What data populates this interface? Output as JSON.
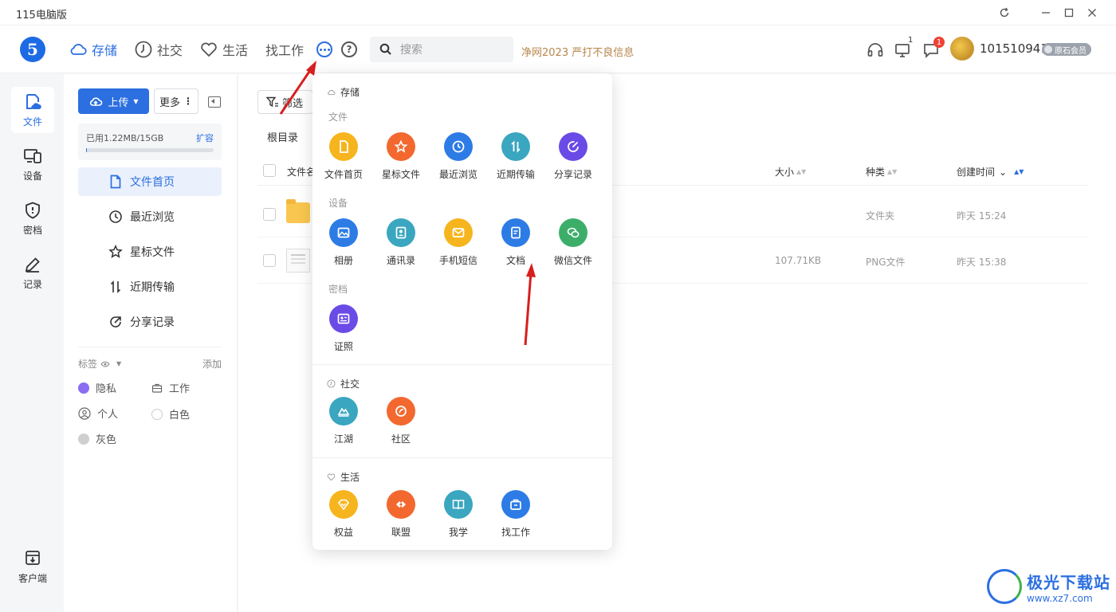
{
  "window": {
    "title": "115电脑版"
  },
  "header": {
    "nav": [
      {
        "label": "存储",
        "icon": "cloud-icon"
      },
      {
        "label": "社交",
        "icon": "compass-icon"
      },
      {
        "label": "生活",
        "icon": "heart-icon"
      },
      {
        "label": "找工作"
      }
    ],
    "search_placeholder": "搜索",
    "banner": "净网2023 严打不良信息",
    "device_count": "1",
    "message_count": "1",
    "user_id": "101510941",
    "member_label": "原石会员"
  },
  "rail": [
    {
      "label": "文件",
      "icon": "file-cloud-icon"
    },
    {
      "label": "设备",
      "icon": "devices-icon"
    },
    {
      "label": "密档",
      "icon": "shield-icon"
    },
    {
      "label": "记录",
      "icon": "pen-icon"
    }
  ],
  "client_label": "客户端",
  "sidebar": {
    "upload_label": "上传",
    "more_label": "更多",
    "storage_used": "已用1.22MB/15GB",
    "storage_expand": "扩容",
    "storage_fraction": 0.0001,
    "nav": [
      {
        "label": "文件首页"
      },
      {
        "label": "最近浏览"
      },
      {
        "label": "星标文件"
      },
      {
        "label": "近期传输"
      },
      {
        "label": "分享记录"
      }
    ],
    "tags_title": "标签",
    "tags_add": "添加",
    "tags": [
      {
        "label": "隐私",
        "color": "#8b6cf2"
      },
      {
        "label": "工作"
      },
      {
        "label": "个人"
      },
      {
        "label": "白色"
      },
      {
        "label": "灰色",
        "color": "#cfcfcf"
      }
    ]
  },
  "main": {
    "filter_label": "筛选",
    "breadcrumb": "根目录",
    "columns": {
      "name": "文件名",
      "size": "大小",
      "type": "种类",
      "created": "创建时间"
    },
    "rows": [
      {
        "size": "",
        "type": "文件夹",
        "created": "昨天 15:24"
      },
      {
        "size": "107.71KB",
        "type": "PNG文件",
        "created": "昨天 15:38"
      }
    ]
  },
  "popup": {
    "storage_title": "存储",
    "files_title": "文件",
    "files": [
      {
        "label": "文件首页",
        "color": "#f6b51e"
      },
      {
        "label": "星标文件",
        "color": "#f3682f"
      },
      {
        "label": "最近浏览",
        "color": "#2d7be5"
      },
      {
        "label": "近期传输",
        "color": "#3aa6c0"
      },
      {
        "label": "分享记录",
        "color": "#6a4be6"
      }
    ],
    "devices_title": "设备",
    "devices": [
      {
        "label": "相册",
        "color": "#2d7be5"
      },
      {
        "label": "通讯录",
        "color": "#3aa6c0"
      },
      {
        "label": "手机短信",
        "color": "#f6b51e"
      },
      {
        "label": "文档",
        "color": "#2d7be5"
      },
      {
        "label": "微信文件",
        "color": "#3dae6a"
      }
    ],
    "vault_title": "密档",
    "vault": [
      {
        "label": "证照",
        "color": "#6a4be6"
      }
    ],
    "social_title": "社交",
    "social": [
      {
        "label": "江湖",
        "color": "#3aa6c0"
      },
      {
        "label": "社区",
        "color": "#f3682f"
      }
    ],
    "life_title": "生活",
    "life": [
      {
        "label": "权益",
        "color": "#f6b51e"
      },
      {
        "label": "联盟",
        "color": "#f3682f"
      },
      {
        "label": "我学",
        "color": "#3aa6c0"
      },
      {
        "label": "找工作",
        "color": "#2d7be5"
      }
    ]
  },
  "watermark": {
    "name": "极光下载站",
    "url": "www.xz7.com"
  },
  "colors": {
    "accent": "#2c6fe0",
    "arrow": "#d81e1e"
  }
}
